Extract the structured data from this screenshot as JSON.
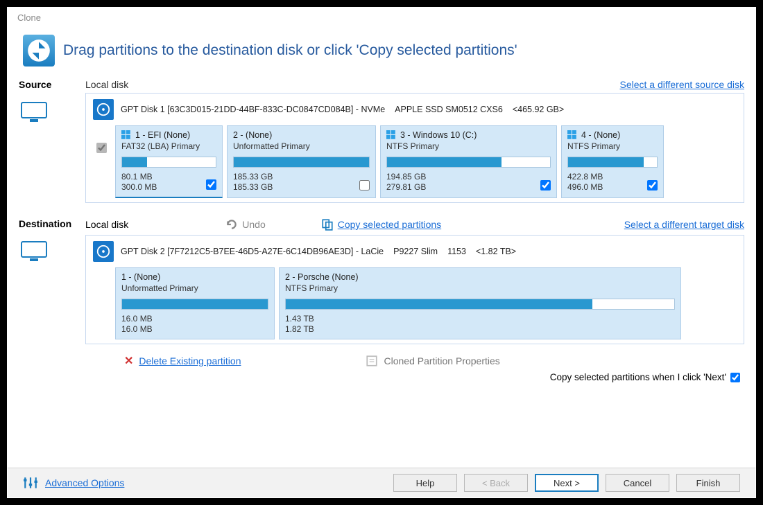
{
  "title": "Clone",
  "headline": "Drag partitions to the destination disk or click 'Copy selected partitions'",
  "source": {
    "label": "Source",
    "local_disk": "Local disk",
    "select_link": "Select a different source disk",
    "disk": {
      "name": "GPT Disk 1 [63C3D015-21DD-44BF-833C-DC0847CD084B] - NVMe",
      "model": "APPLE SSD SM0512 CXS6",
      "size": "<465.92 GB>"
    },
    "partitions": [
      {
        "title": "1 - EFI (None)",
        "subtitle": "FAT32 (LBA) Primary",
        "used": "80.1 MB",
        "total": "300.0 MB",
        "fill": 27,
        "checked": true,
        "win": true,
        "selected": true
      },
      {
        "title": "2 -  (None)",
        "subtitle": "Unformatted Primary",
        "used": "185.33 GB",
        "total": "185.33 GB",
        "fill": 100,
        "checked": false,
        "win": false,
        "selected": false
      },
      {
        "title": "3 - Windows 10 (C:)",
        "subtitle": "NTFS Primary",
        "used": "194.85 GB",
        "total": "279.81 GB",
        "fill": 70,
        "checked": true,
        "win": true,
        "selected": false
      },
      {
        "title": "4 -  (None)",
        "subtitle": "NTFS Primary",
        "used": "422.8 MB",
        "total": "496.0 MB",
        "fill": 85,
        "checked": true,
        "win": true,
        "selected": false
      }
    ]
  },
  "destination": {
    "label": "Destination",
    "local_disk": "Local disk",
    "undo": "Undo",
    "copy_link": "Copy selected partitions",
    "select_link": "Select a different target disk",
    "disk": {
      "name": "GPT Disk 2 [7F7212C5-B7EE-46D5-A27E-6C14DB96AE3D] - LaCie",
      "model": "P9227 Slim",
      "extra": "1153",
      "size": "<1.82 TB>"
    },
    "partitions": [
      {
        "title": "1 -  (None)",
        "subtitle": "Unformatted Primary",
        "used": "16.0 MB",
        "total": "16.0 MB",
        "fill": 100
      },
      {
        "title": "2 - Porsche (None)",
        "subtitle": "NTFS Primary",
        "used": "1.43 TB",
        "total": "1.82 TB",
        "fill": 79
      }
    ]
  },
  "actions": {
    "delete": "Delete Existing partition",
    "cloned_props": "Cloned Partition Properties",
    "copy_on_next": "Copy selected partitions when I click 'Next'"
  },
  "buttons": {
    "advanced": "Advanced Options",
    "help": "Help",
    "back": "< Back",
    "next": "Next >",
    "cancel": "Cancel",
    "finish": "Finish"
  }
}
